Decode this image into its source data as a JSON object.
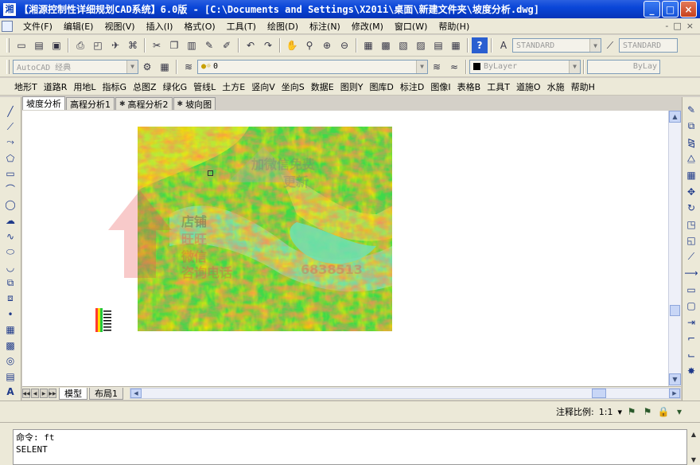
{
  "titlebar": {
    "title": "【湘源控制性详细规划CAD系统】6.0版  - [C:\\Documents and Settings\\X201i\\桌面\\新建文件夹\\坡度分析.dwg]",
    "app_icon": "湘",
    "minimize": "_",
    "maximize": "□",
    "close": "×"
  },
  "menubar": {
    "items": [
      "文件(F)",
      "编辑(E)",
      "视图(V)",
      "插入(I)",
      "格式(O)",
      "工具(T)",
      "绘图(D)",
      "标注(N)",
      "修改(M)",
      "窗口(W)",
      "帮助(H)"
    ],
    "mdi_controls": [
      "-",
      "□",
      "×"
    ]
  },
  "toolbar": {
    "text_style": "STANDARD",
    "dim_style": "STANDARD",
    "workspace": "AutoCAD 经典",
    "layer": "0",
    "color": "ByLayer",
    "linetype": "ByLay"
  },
  "custom_menu": {
    "items": [
      "地形T",
      "道路R",
      "用地L",
      "指标G",
      "总图Z",
      "绿化G",
      "管线L",
      "土方E",
      "竖向V",
      "坐向S",
      "数据E",
      "图则Y",
      "图库D",
      "标注D",
      "图像I",
      "表格B",
      "工具T",
      "道施O",
      "水施",
      "帮助H"
    ]
  },
  "doc_tabs": [
    {
      "label": "坡度分析",
      "active": true,
      "closable": false
    },
    {
      "label": "高程分析1",
      "active": false,
      "closable": false
    },
    {
      "label": "高程分析2",
      "active": false,
      "closable": true
    },
    {
      "label": "坡向图",
      "active": false,
      "closable": true
    }
  ],
  "layout_tabs": [
    {
      "label": "模型",
      "active": true
    },
    {
      "label": "布局1",
      "active": false
    }
  ],
  "status": {
    "annotation_scale_label": "注释比例:",
    "annotation_scale_value": "1:1"
  },
  "command": {
    "line1": "命令: ft",
    "line2": "SELENT"
  },
  "watermark": {
    "line1": "加微信免费",
    "line2": "更新",
    "line3": "店铺",
    "line4": "旺旺",
    "line5": "微信",
    "line6": "咨询电话",
    "number": "6838513"
  },
  "icons": {
    "slope_colors": [
      "#ff3b30",
      "#ff9f0a",
      "#ffe000",
      "#7fe030",
      "#22c83a",
      "#4ad0a0"
    ]
  }
}
